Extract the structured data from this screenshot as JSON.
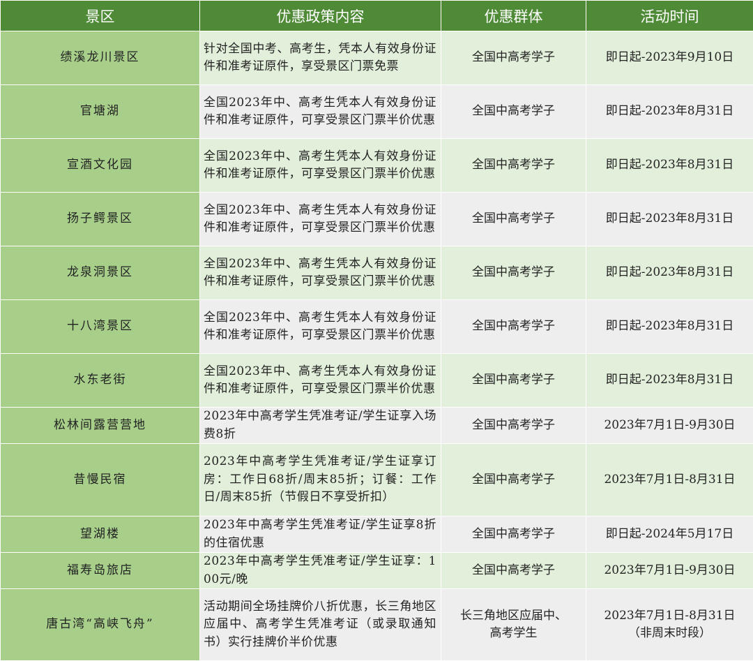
{
  "headers": {
    "spot": "景区",
    "policy": "优惠政策内容",
    "group": "优惠群体",
    "time": "活动时间"
  },
  "rows": [
    {
      "spot": "绩溪龙川景区",
      "policy": "针对全国中考、高考生，凭本人有效身份证件和准考证原件，享受景区门票免票",
      "group": "全国中高考学子",
      "time": "即日起-2023年9月10日"
    },
    {
      "spot": "官塘湖",
      "policy": "全国2023年中、高考生凭本人有效身份证件和准考证原件，可享受景区门票半价优惠",
      "group": "全国中高考学子",
      "time": "即日起-2023年8月31日"
    },
    {
      "spot": "宣酒文化园",
      "policy": "全国2023年中、高考生凭本人有效身份证件和准考证原件，可享受景区门票半价优惠",
      "group": "全国中高考学子",
      "time": "即日起-2023年8月31日"
    },
    {
      "spot": "扬子鳄景区",
      "policy": "全国2023年中、高考生凭本人有效身份证件和准考证原件，可享受景区门票半价优惠",
      "group": "全国中高考学子",
      "time": "即日起-2023年8月31日"
    },
    {
      "spot": "龙泉洞景区",
      "policy": "全国2023年中、高考生凭本人有效身份证件和准考证原件，可享受景区门票半价优惠",
      "group": "全国中高考学子",
      "time": "即日起-2023年8月31日"
    },
    {
      "spot": "十八湾景区",
      "policy": "全国2023年中、高考生凭本人有效身份证件和准考证原件，可享受景区门票半价优惠",
      "group": "全国中高考学子",
      "time": "即日起-2023年8月31日"
    },
    {
      "spot": "水东老街",
      "policy": "全国2023年中、高考生凭本人有效身份证件和准考证原件，可享受景区门票半价优惠",
      "group": "全国中高考学子",
      "time": "即日起-2023年8月31日"
    },
    {
      "spot": "松林间露营营地",
      "policy": "2023年中高考学生凭准考证/学生证享入场费8折",
      "group": "全国中高考学子",
      "time": "2023年7月1日-9月30日"
    },
    {
      "spot": "昔慢民宿",
      "policy": "2023年中高考学生凭准考证/学生证享订房：工作日68折/周末85折；订餐：工作日/周末85折（节假日不享受折扣）",
      "group": "全国中高考学子",
      "time": "2023年7月1日-8月31日"
    },
    {
      "spot": "望湖楼",
      "policy": "2023年中高考学生凭准考证/学生证享8折的住宿优惠",
      "group": "全国中高考学子",
      "time": "即日起-2024年5月17日"
    },
    {
      "spot": "福寿岛旅店",
      "policy": "2023年中高考学生凭准考证/学生证享：100元/晚",
      "group": "全国中高考学子",
      "time": "2023年7月1日-9月30日"
    },
    {
      "spot": "唐古湾“高峡飞舟”",
      "policy": "活动期间全场挂牌价八折优惠，长三角地区应届中、高考学生凭准考证（或录取通知书）实行挂牌价半价优惠",
      "group": "长三角地区应届中、\n高考学生",
      "time": "2023年7月1日-8月31日\n（非周末时段）"
    }
  ]
}
